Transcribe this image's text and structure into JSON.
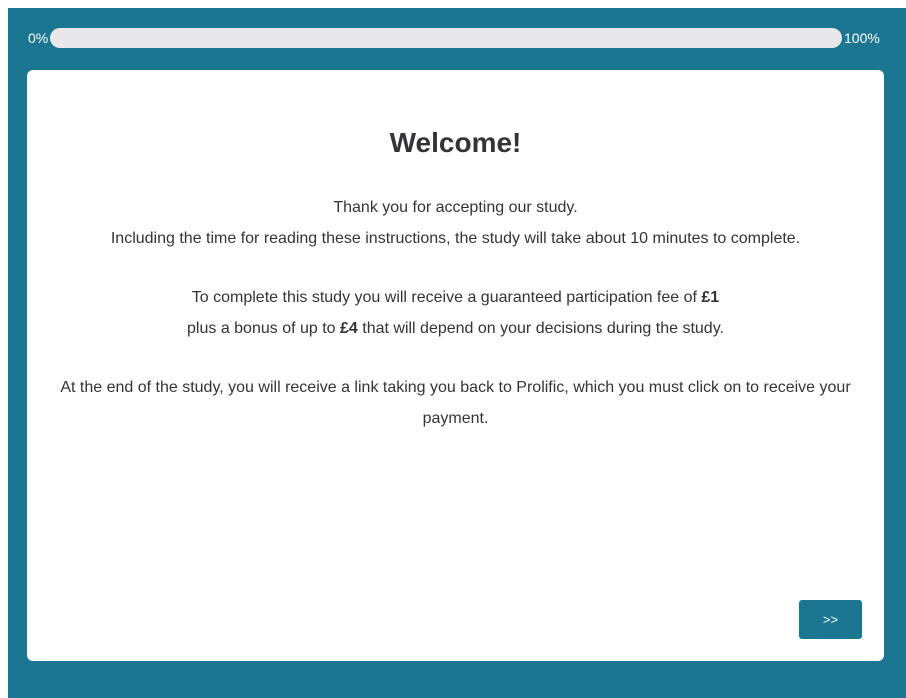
{
  "progress": {
    "start_label": "0%",
    "end_label": "100%",
    "value": 0
  },
  "content": {
    "title": "Welcome!",
    "p1_line1": "Thank you for accepting our study.",
    "p1_line2": "Including the time for reading these instructions, the study will take about 10 minutes to complete.",
    "p2_line1_text": "To complete this study you will receive a guaranteed participation fee of ",
    "p2_line1_amount": "£1",
    "p2_line2_pre": "plus a bonus of up to ",
    "p2_line2_amount": "£4",
    "p2_line2_post": " that will depend on your decisions during the study.",
    "p3_text": "At the end of the study, you will receive a link taking you back to Prolific, which you must click on to receive your payment."
  },
  "nav": {
    "next_label": ">>"
  },
  "colors": {
    "background": "#1a7691",
    "progress_track": "#e8e8ea",
    "text": "#333339"
  }
}
